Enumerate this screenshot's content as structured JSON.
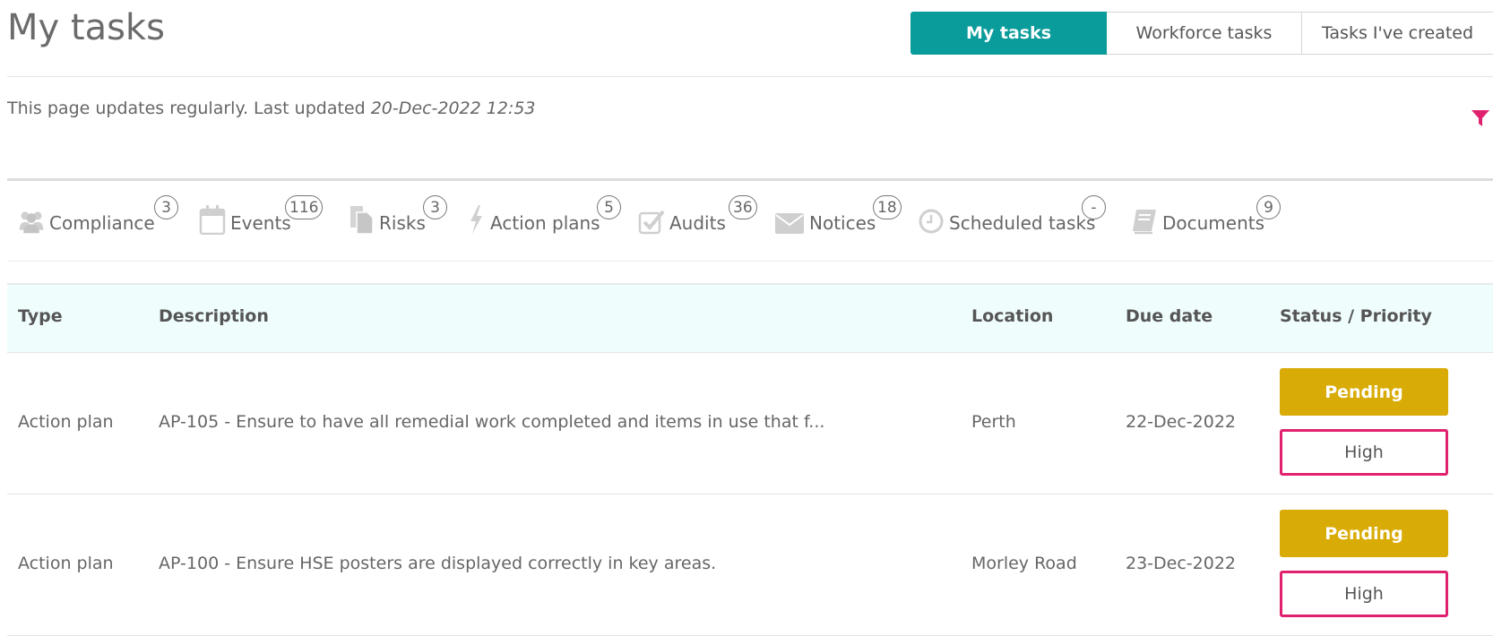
{
  "page": {
    "title": "My tasks",
    "updated_prefix": "This page updates regularly. Last updated ",
    "updated_time": "20-Dec-2022 12:53"
  },
  "tabs": [
    {
      "label": "My tasks",
      "active": true
    },
    {
      "label": "Workforce tasks",
      "active": false
    },
    {
      "label": "Tasks I've created",
      "active": false
    }
  ],
  "categories": [
    {
      "label": "Compliance",
      "count": "3",
      "icon": "people-icon"
    },
    {
      "label": "Events",
      "count": "116",
      "icon": "calendar-icon"
    },
    {
      "label": "Risks",
      "count": "3",
      "icon": "documents-icon"
    },
    {
      "label": "Action plans",
      "count": "5",
      "icon": "lightning-icon"
    },
    {
      "label": "Audits",
      "count": "36",
      "icon": "checkbox-icon"
    },
    {
      "label": "Notices",
      "count": "18",
      "icon": "envelope-icon"
    },
    {
      "label": "Scheduled tasks",
      "count": "-",
      "icon": "clock-icon"
    },
    {
      "label": "Documents",
      "count": "9",
      "icon": "book-icon"
    }
  ],
  "table": {
    "headers": {
      "type": "Type",
      "description": "Description",
      "location": "Location",
      "due": "Due date",
      "status": "Status / Priority"
    },
    "rows": [
      {
        "type": "Action plan",
        "description": "AP-105 - Ensure to have all remedial work completed and items in use that f...",
        "location": "Perth",
        "due": "22-Dec-2022",
        "status": "Pending",
        "priority": "High"
      },
      {
        "type": "Action plan",
        "description": "AP-100 - Ensure HSE posters are displayed correctly in key areas.",
        "location": "Morley Road",
        "due": "23-Dec-2022",
        "status": "Pending",
        "priority": "High"
      }
    ]
  },
  "colors": {
    "accent": "#0a9b9b",
    "pending": "#d9ab06",
    "high_priority": "#e0226e",
    "filter": "#e0226e",
    "header_bg": "#f0fdfd"
  }
}
